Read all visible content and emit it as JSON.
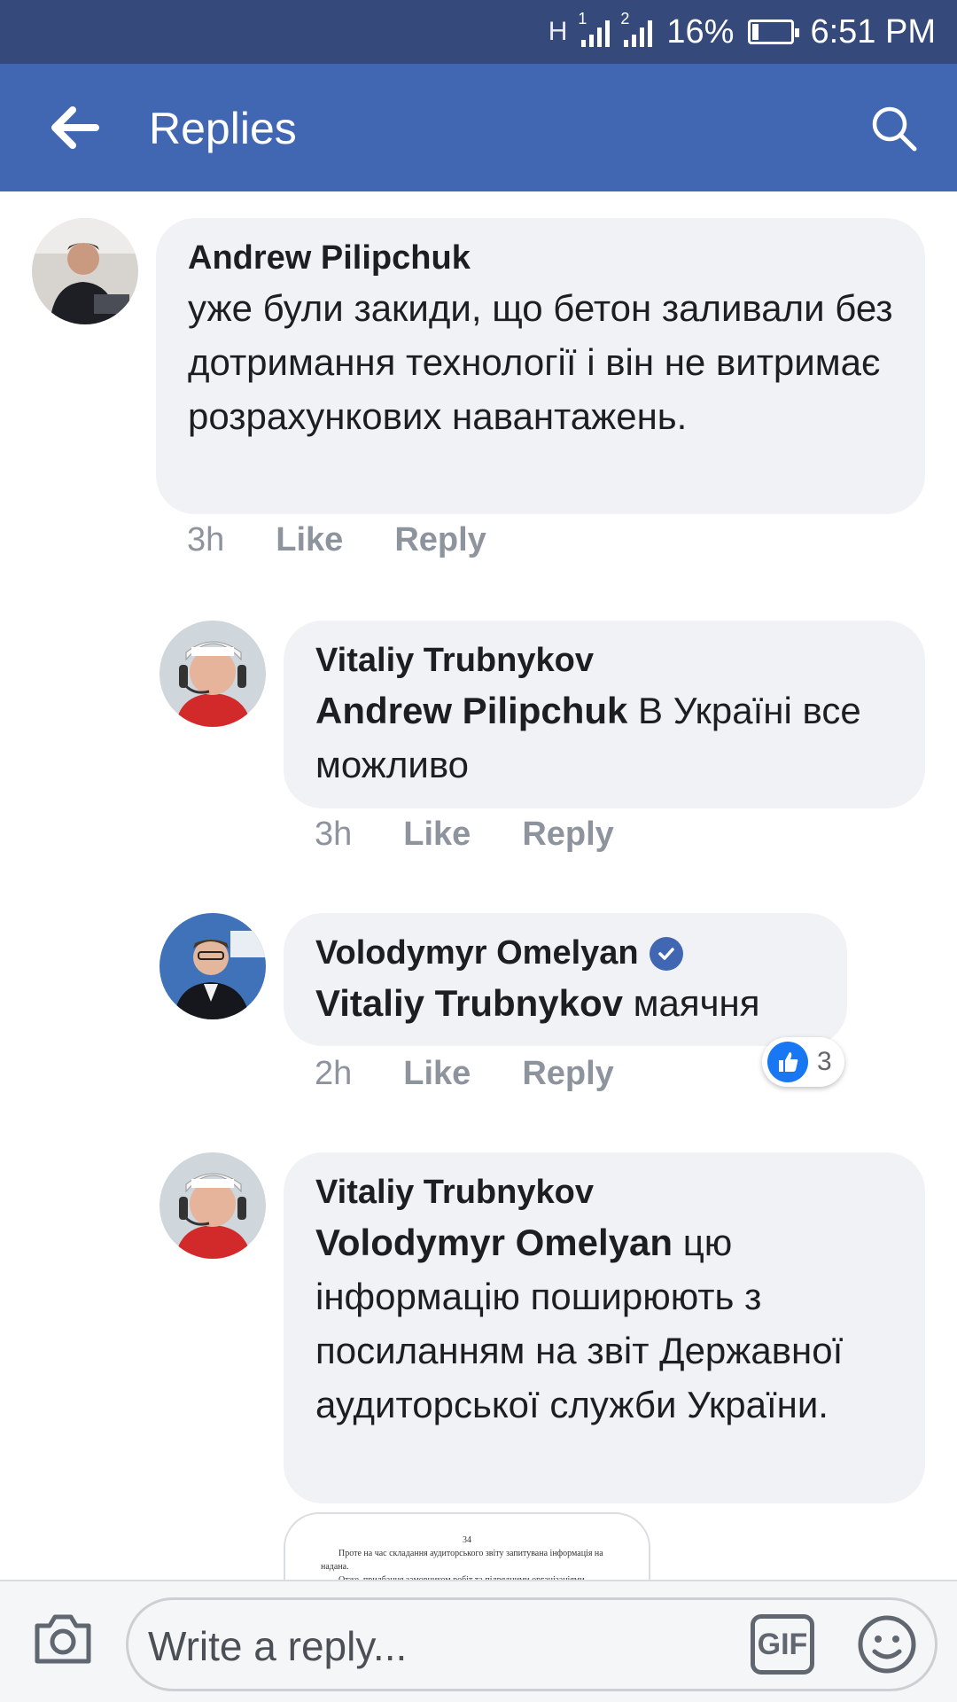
{
  "status_bar": {
    "network": "H",
    "sim1": "1",
    "sim2": "2",
    "battery": "16%",
    "time": "6:51 PM"
  },
  "app_bar": {
    "title": "Replies"
  },
  "comments": [
    {
      "author": "Andrew Pilipchuk",
      "mention": "",
      "text": "уже були закиди, що бетон заливали без дотримання технології і він не витримає розрахункових навантажень.",
      "time": "3h",
      "like": "Like",
      "reply": "Reply"
    },
    {
      "author": "Vitaliy Trubnykov",
      "mention": "Andrew Pilipchuk",
      "text": " В Україні все можливо",
      "time": "3h",
      "like": "Like",
      "reply": "Reply"
    },
    {
      "author": "Volodymyr Omelyan",
      "verified": true,
      "mention": "Vitaliy Trubnykov",
      "text": " маячня",
      "time": "2h",
      "like": "Like",
      "reply": "Reply",
      "reaction_count": "3"
    },
    {
      "author": "Vitaliy Trubnykov",
      "mention": "Volodymyr Omelyan",
      "text": " цю інформацію поширюють з посиланням на звіт Державної аудиторської служби України."
    }
  ],
  "attachment": {
    "page_number": "34",
    "line1": "Проте на час складання аудиторського звіту запитувана інформація на",
    "line2": "надана.",
    "line3": "Отже, придбання замовником робіт та підрядними організаціями"
  },
  "composer": {
    "placeholder": "Write a reply...",
    "gif_label": "GIF"
  },
  "colors": {
    "status_bar": "#35497a",
    "app_bar": "#4267b2",
    "bubble": "#f0f2f5",
    "meta_text": "#8d949e",
    "like_blue": "#1877f2"
  },
  "icons": [
    "back-arrow-icon",
    "search-icon",
    "verified-icon",
    "like-icon",
    "camera-icon",
    "gif-icon",
    "emoji-icon"
  ]
}
